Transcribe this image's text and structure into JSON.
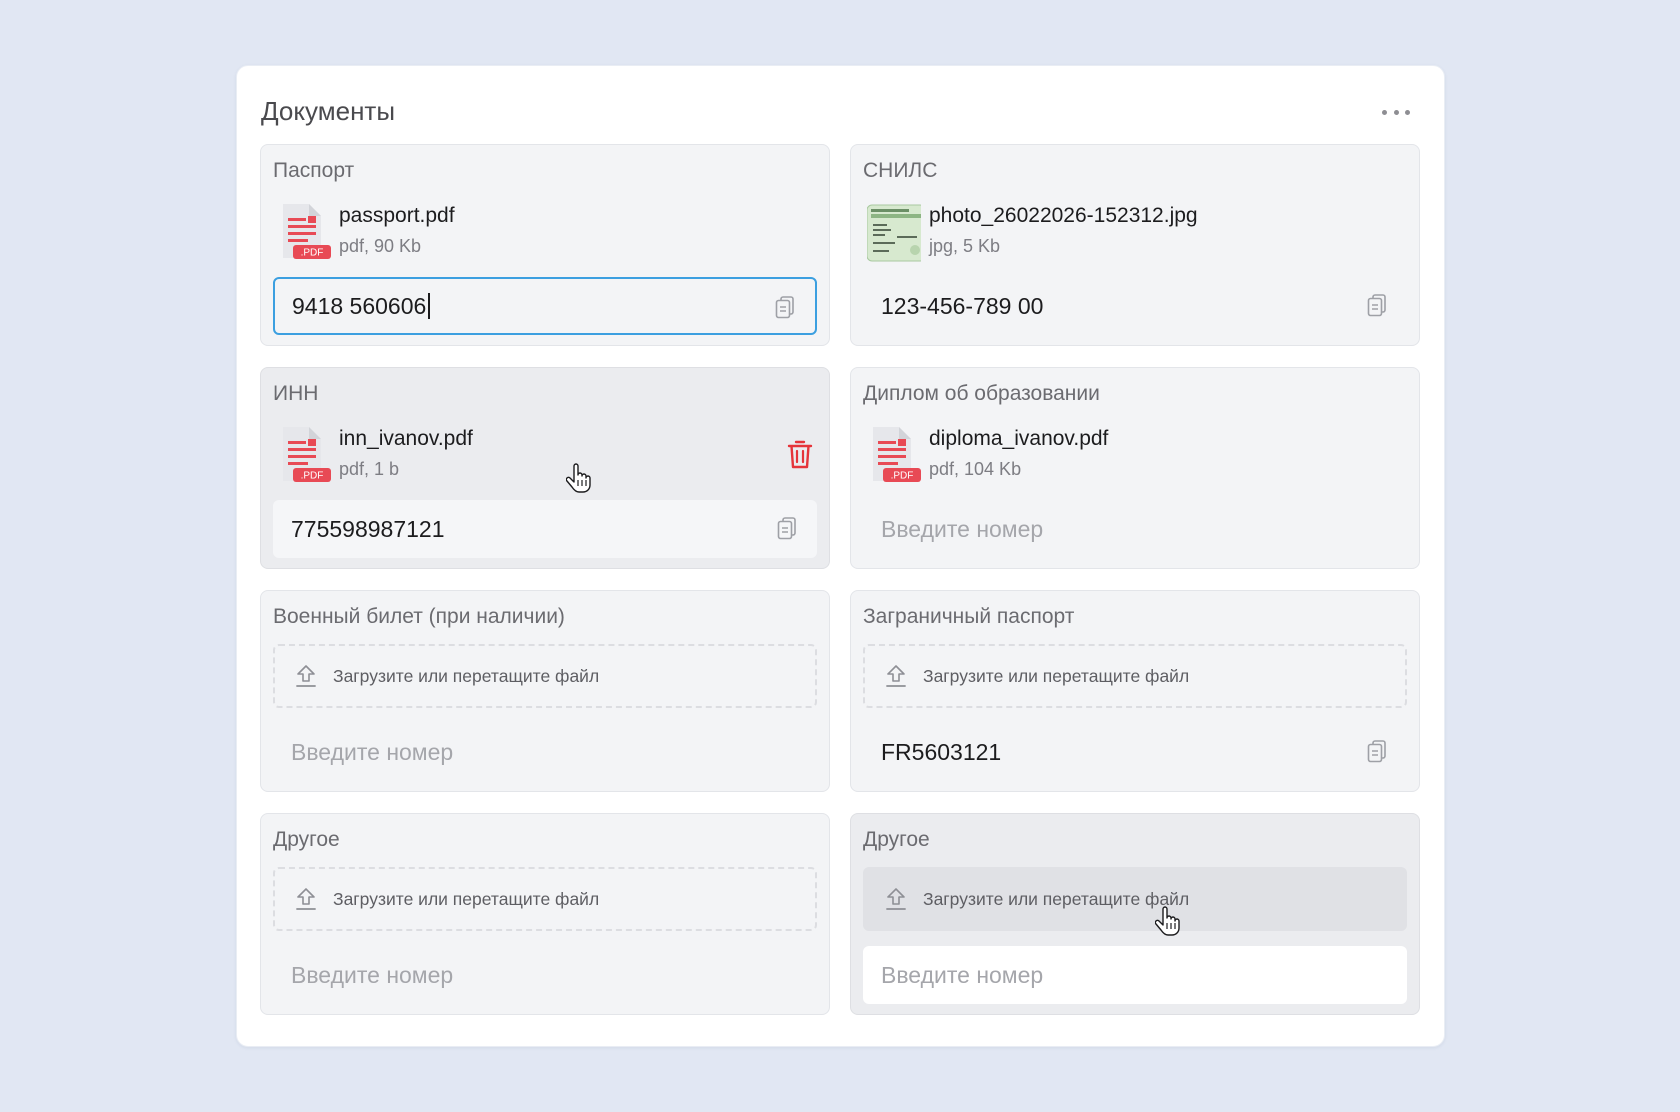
{
  "panel": {
    "title": "Документы"
  },
  "labels": {
    "upload": "Загрузите или перетащите файл",
    "number_placeholder": "Введите номер"
  },
  "cards": [
    {
      "title": "Паспорт",
      "file": {
        "name": "passport.pdf",
        "meta": "pdf, 90 Kb",
        "type": "pdf"
      },
      "number": "9418 560606"
    },
    {
      "title": "СНИЛС",
      "file": {
        "name": "photo_26022026-152312.jpg",
        "meta": "jpg, 5 Kb",
        "type": "jpg"
      },
      "number": "123-456-789 00"
    },
    {
      "title": "ИНН",
      "file": {
        "name": "inn_ivanov.pdf",
        "meta": "pdf, 1 b",
        "type": "pdf"
      },
      "number": "775598987121"
    },
    {
      "title": "Диплом об образовании",
      "file": {
        "name": "diploma_ivanov.pdf",
        "meta": "pdf, 104 Kb",
        "type": "pdf"
      },
      "number": ""
    },
    {
      "title": "Военный билет (при наличии)",
      "number": ""
    },
    {
      "title": "Заграничный паспорт",
      "number": "FR5603121"
    },
    {
      "title": "Другое",
      "number": ""
    },
    {
      "title": "Другое",
      "number": ""
    }
  ],
  "pdf_badge": ".PDF",
  "colors": {
    "focus": "#3b9fe0",
    "danger": "#e5343a",
    "pdf": "#e84a55",
    "background": "#e1e7f3"
  },
  "icons": [
    "more-icon",
    "pdf-file-icon",
    "image-thumbnail-icon",
    "trash-icon",
    "copy-icon",
    "upload-icon",
    "hand-cursor-icon"
  ]
}
